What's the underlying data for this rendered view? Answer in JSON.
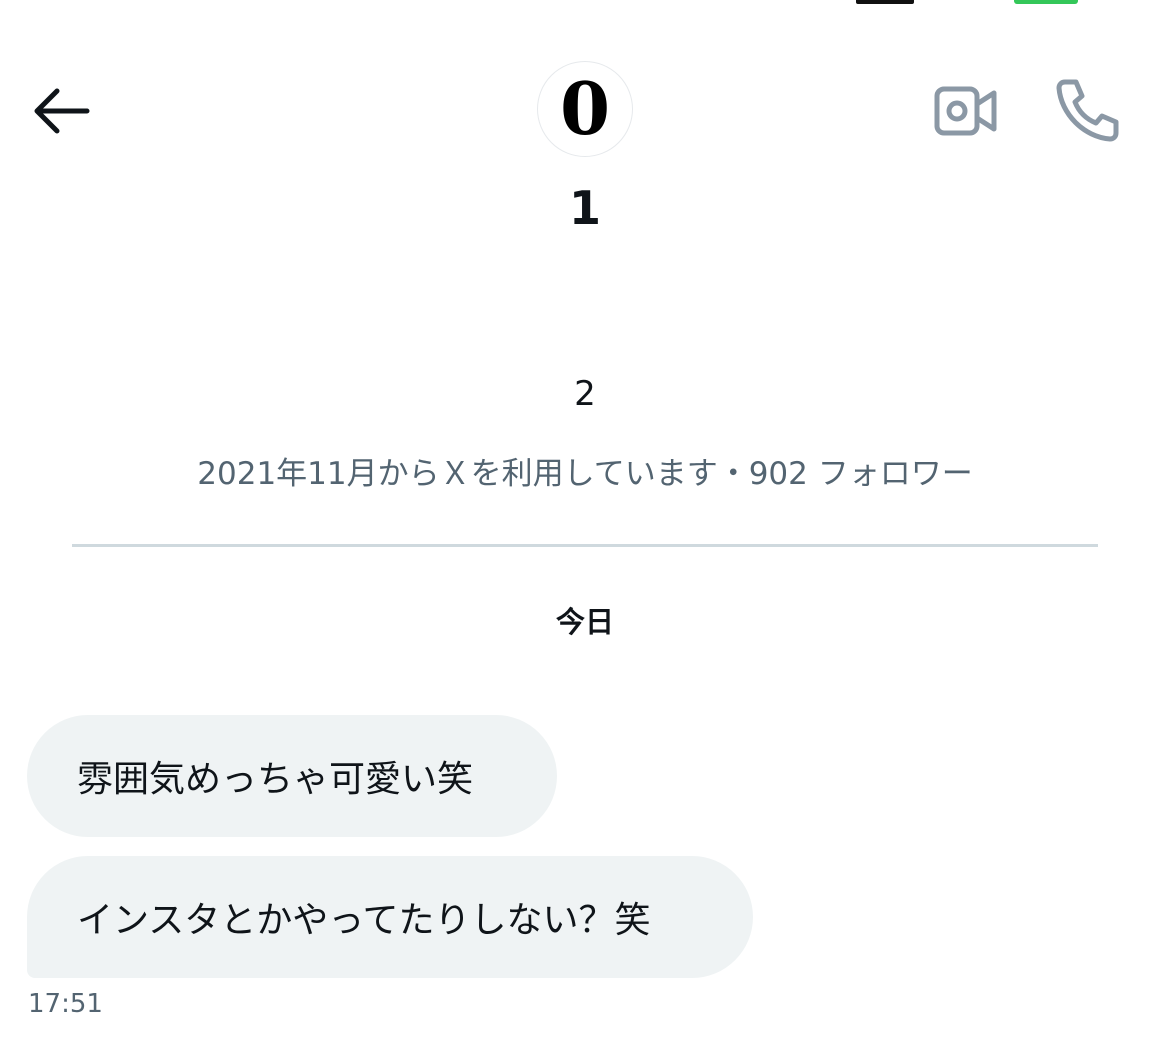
{
  "status_bar": {
    "cellular_color": "#111111",
    "battery_color": "#34c759"
  },
  "header": {
    "back_icon": "arrow-left-icon",
    "video_call_icon": "video-camera-icon",
    "voice_call_icon": "phone-icon",
    "icon_color_primary": "#0f1419",
    "icon_color_muted": "#8b98a5"
  },
  "profile": {
    "avatar_text": "0",
    "display_name": "1",
    "bio": "2",
    "meta": "2021年11月からＸを利用しています・902 フォロワー"
  },
  "conversation": {
    "day_label": "今日",
    "messages": [
      {
        "text": "雰囲気めっちゃ可愛い笑"
      },
      {
        "text": "インスタとかやってたりしない？笑"
      }
    ],
    "last_timestamp": "17:51"
  },
  "colors": {
    "bubble_bg": "#eff3f4",
    "secondary_text": "#536471",
    "divider": "#cfd9de"
  }
}
